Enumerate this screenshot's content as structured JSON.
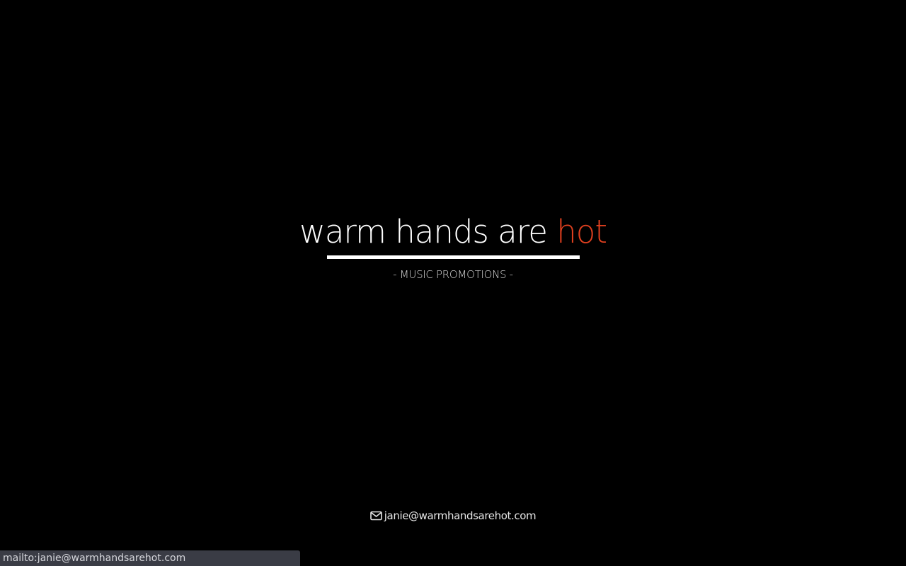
{
  "hero": {
    "title_main": "warm hands are ",
    "title_accent": "hot",
    "subtitle": "- MUSIC PROMOTIONS -"
  },
  "contact": {
    "icon": "envelope-icon",
    "email": "janie@warmhandsarehot.com"
  },
  "status_bar": {
    "link_preview": "mailto:janie@warmhandsarehot.com"
  },
  "colors": {
    "background": "#000000",
    "accent": "#e0401f",
    "text": "#ffffff",
    "status_bar_bg": "#3a3c45"
  }
}
